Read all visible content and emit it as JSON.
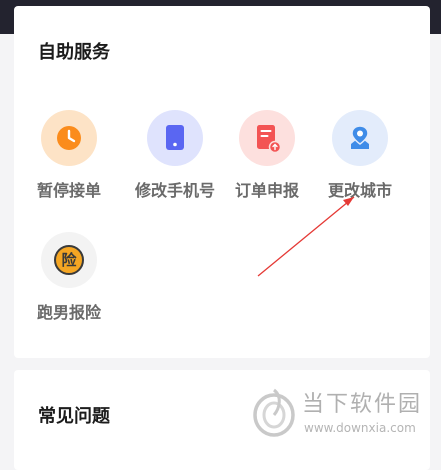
{
  "self_service": {
    "title": "自助服务",
    "items": [
      {
        "label": "暂停接单",
        "icon": "clock-icon",
        "bg": "#fde3c6",
        "fg": "#fb8c1c"
      },
      {
        "label": "修改手机号",
        "icon": "phone-icon",
        "bg": "#dfe3fd",
        "fg": "#5a66f2"
      },
      {
        "label": "订单申报",
        "icon": "document-icon",
        "bg": "#fde0de",
        "fg": "#f35454"
      },
      {
        "label": "更改城市",
        "icon": "location-icon",
        "bg": "#e3ecfb",
        "fg": "#3f8ce8"
      },
      {
        "label": "跑男报险",
        "icon": "insurance-icon",
        "bg": "#f3f3f3",
        "fg": "#f5a623",
        "badge_text": "险"
      }
    ]
  },
  "faq": {
    "title": "常见问题"
  },
  "watermark": {
    "brand": "当下软件园",
    "url": "www.downxia.com"
  },
  "colors": {
    "annotation_arrow": "#e53935",
    "header_dark": "#23232f"
  }
}
